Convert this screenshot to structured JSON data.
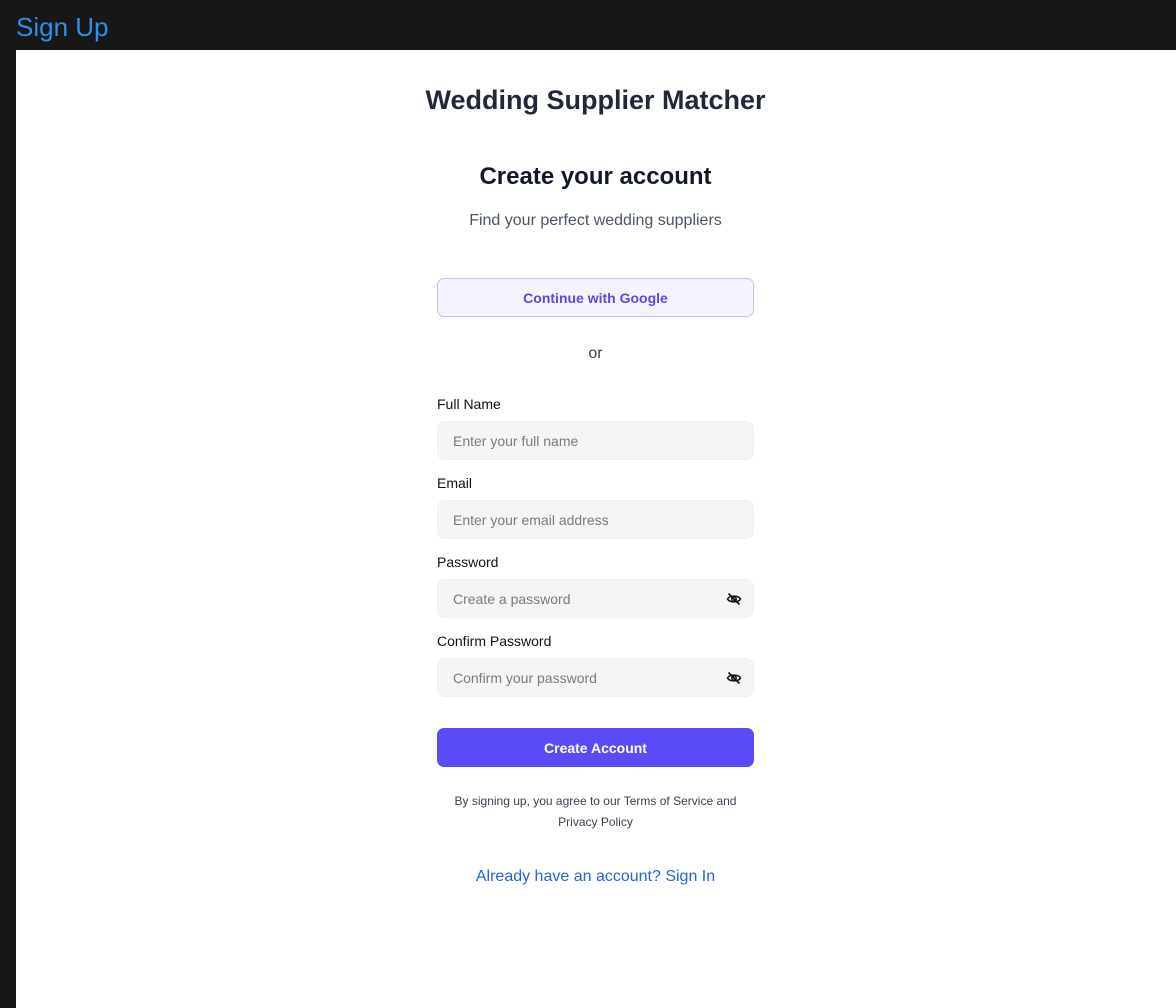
{
  "topbar": {
    "title": "Sign Up"
  },
  "header": {
    "app_name": "Wedding Supplier Matcher",
    "heading": "Create your account",
    "subheading": "Find your perfect wedding suppliers"
  },
  "google_button": {
    "label": "Continue with Google"
  },
  "divider": {
    "label": "or"
  },
  "form": {
    "full_name": {
      "label": "Full Name",
      "placeholder": "Enter your full name",
      "value": ""
    },
    "email": {
      "label": "Email",
      "placeholder": "Enter your email address",
      "value": ""
    },
    "password": {
      "label": "Password",
      "placeholder": "Create a password",
      "value": "",
      "toggle_icon": "eye-off-icon"
    },
    "confirm_password": {
      "label": "Confirm Password",
      "placeholder": "Confirm your password",
      "value": "",
      "toggle_icon": "eye-off-icon"
    }
  },
  "submit_button": {
    "label": "Create Account"
  },
  "terms": {
    "text": "By signing up, you agree to our Terms of Service and Privacy Policy"
  },
  "signin": {
    "label": "Already have an account? Sign In"
  },
  "colors": {
    "topbar_bg": "#171717",
    "topbar_title": "#2d8fe6",
    "primary": "#5b4af7",
    "google_text": "#6347d9",
    "link": "#2563d9"
  }
}
